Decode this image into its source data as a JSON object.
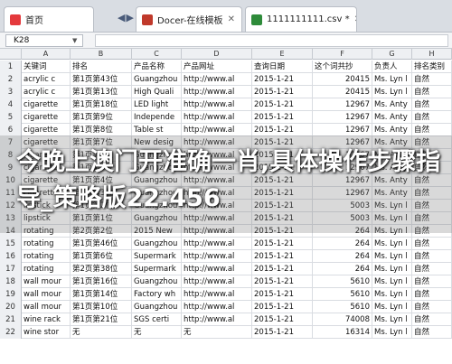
{
  "tabs": [
    {
      "label": "首页",
      "color": "#e4393c"
    },
    {
      "label": "Docer-在线模板",
      "color": "#c0392b"
    },
    {
      "label": "1111111111.csv *",
      "color": "#2e8b3a"
    }
  ],
  "name_box": {
    "value": "K28"
  },
  "columns": [
    "A",
    "B",
    "C",
    "D",
    "E",
    "F",
    "G",
    "H"
  ],
  "rows": [
    {
      "n": "1",
      "cells": [
        "关键词",
        "排名",
        "产品名称",
        "产品网址",
        "查询日期",
        "这个词共抄",
        "负责人",
        "排名类别"
      ]
    },
    {
      "n": "2",
      "cells": [
        "acrylic c",
        "第1页第43位",
        "Guangzhou",
        "http://www.al",
        "2015-1-21",
        "20415",
        "Ms. Lyn l",
        "自然"
      ]
    },
    {
      "n": "3",
      "cells": [
        "acrylic c",
        "第1页第13位",
        "High Quali",
        "http://www.al",
        "2015-1-21",
        "20415",
        "Ms. Lyn l",
        "自然"
      ]
    },
    {
      "n": "4",
      "cells": [
        "cigarette",
        "第1页第18位",
        "LED light",
        "http://www.al",
        "2015-1-21",
        "12967",
        "Ms. Anty",
        "自然"
      ]
    },
    {
      "n": "5",
      "cells": [
        "cigarette",
        "第1页第9位",
        "Independe",
        "http://www.al",
        "2015-1-21",
        "12967",
        "Ms. Anty",
        "自然"
      ]
    },
    {
      "n": "6",
      "cells": [
        "cigarette",
        "第1页第8位",
        "Table st",
        "http://www.al",
        "2015-1-21",
        "12967",
        "Ms. Anty",
        "自然"
      ]
    },
    {
      "n": "7",
      "cells": [
        "cigarette",
        "第1页第7位",
        "New desig",
        "http://www.al",
        "2015-1-21",
        "12967",
        "Ms. Anty",
        "自然"
      ]
    },
    {
      "n": "8",
      "cells": [
        "cigarette",
        "第1页第6位",
        "Guangzhou",
        "http://www.al",
        "2015-1-21",
        "12967",
        "Ms. Anty",
        "自然"
      ]
    },
    {
      "n": "9",
      "cells": [
        "cigarette",
        "第1页第5位",
        "Guangzhou",
        "http://www.al",
        "2015-1-21",
        "12967",
        "Ms. Anty",
        "自然"
      ]
    },
    {
      "n": "10",
      "cells": [
        "cigarette",
        "第1页第4位",
        "Guangzhou",
        "http://www.al",
        "2015-1-21",
        "12967",
        "Ms. Anty",
        "自然"
      ]
    },
    {
      "n": "11",
      "cells": [
        "cigarette",
        "第1页第3位",
        "Guangzhou",
        "http://www.al",
        "2015-1-21",
        "12967",
        "Ms. Anty",
        "自然"
      ]
    },
    {
      "n": "12",
      "cells": [
        "lipstick",
        "第1页第2位",
        "Guangzhou",
        "http://www.al",
        "2015-1-21",
        "5003",
        "Ms. Lyn l",
        "自然"
      ]
    },
    {
      "n": "13",
      "cells": [
        "lipstick",
        "第1页第1位",
        "Guangzhou",
        "http://www.al",
        "2015-1-21",
        "5003",
        "Ms. Lyn l",
        "自然"
      ]
    },
    {
      "n": "14",
      "cells": [
        "rotating",
        "第2页第2位",
        "2015 New",
        "http://www.al",
        "2015-1-21",
        "264",
        "Ms. Lyn l",
        "自然"
      ]
    },
    {
      "n": "15",
      "cells": [
        "rotating",
        "第1页第46位",
        "Guangzhou",
        "http://www.al",
        "2015-1-21",
        "264",
        "Ms. Lyn l",
        "自然"
      ]
    },
    {
      "n": "16",
      "cells": [
        "rotating",
        "第1页第6位",
        "Supermark",
        "http://www.al",
        "2015-1-21",
        "264",
        "Ms. Lyn l",
        "自然"
      ]
    },
    {
      "n": "17",
      "cells": [
        "rotating",
        "第2页第38位",
        "Supermark",
        "http://www.al",
        "2015-1-21",
        "264",
        "Ms. Lyn l",
        "自然"
      ]
    },
    {
      "n": "18",
      "cells": [
        "wall mour",
        "第1页第16位",
        "Guangzhou",
        "http://www.al",
        "2015-1-21",
        "5610",
        "Ms. Lyn l",
        "自然"
      ]
    },
    {
      "n": "19",
      "cells": [
        "wall mour",
        "第1页第14位",
        "Factory wh",
        "http://www.al",
        "2015-1-21",
        "5610",
        "Ms. Lyn l",
        "自然"
      ]
    },
    {
      "n": "20",
      "cells": [
        "wall mour",
        "第1页第10位",
        "Guangzhou",
        "http://www.al",
        "2015-1-21",
        "5610",
        "Ms. Lyn l",
        "自然"
      ]
    },
    {
      "n": "21",
      "cells": [
        "wine rack",
        "第1页第21位",
        "SGS certi",
        "http://www.al",
        "2015-1-21",
        "74008",
        "Ms. Lyn l",
        "自然"
      ]
    },
    {
      "n": "22",
      "cells": [
        "wine stor",
        "无",
        "无",
        "无",
        "2015-1-21",
        "16314",
        "Ms. Lyn l",
        "自然"
      ]
    }
  ],
  "headline": "今晚上澳门开准确一肖,具体操作步骤指导_策略版22.456"
}
